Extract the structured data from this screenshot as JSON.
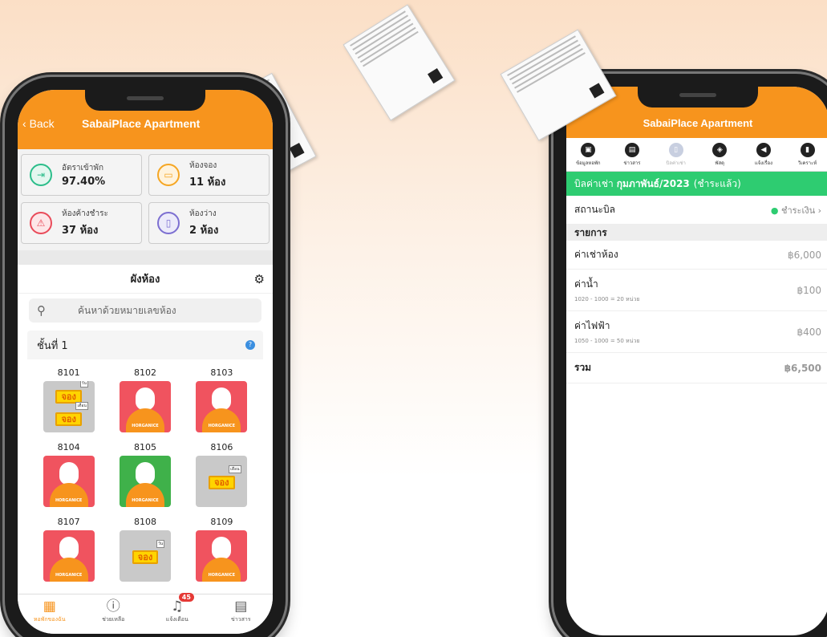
{
  "left_app": {
    "back": "Back",
    "title": "SabaiPlace Apartment",
    "stats": [
      {
        "label": "อัตราเข้าพัก",
        "value": "97.40%",
        "color": "#2bbd8a",
        "icon": "enter-icon"
      },
      {
        "label": "ห้องจอง",
        "value": "11 ห้อง",
        "color": "#f5a623",
        "icon": "booking-icon"
      },
      {
        "label": "ห้องค้างชำระ",
        "value": "37 ห้อง",
        "color": "#e94b5a",
        "icon": "overdue-icon"
      },
      {
        "label": "ห้องว่าง",
        "value": "2 ห้อง",
        "color": "#7c6fd1",
        "icon": "vacant-icon"
      }
    ],
    "section_title": "ผังห้อง",
    "search_placeholder": "ค้นหาด้วยหมายเลขห้อง",
    "floor_label": "ชั้นที่ 1",
    "rooms": [
      {
        "num": "8101",
        "status": "reserved-double"
      },
      {
        "num": "8102",
        "status": "overdue"
      },
      {
        "num": "8103",
        "status": "overdue"
      },
      {
        "num": "8104",
        "status": "overdue"
      },
      {
        "num": "8105",
        "status": "paid"
      },
      {
        "num": "8106",
        "status": "reserved-month"
      },
      {
        "num": "8107",
        "status": "overdue"
      },
      {
        "num": "8108",
        "status": "reserved-day"
      },
      {
        "num": "8109",
        "status": "overdue"
      }
    ],
    "tile_brand": "HORGANICE",
    "sign_text": "จอง",
    "cal_day": "วัน",
    "cal_month": "เดือน",
    "tabs": [
      {
        "label": "หอพักของฉัน",
        "icon": "building-icon"
      },
      {
        "label": "ช่วยเหลือ",
        "icon": "help-icon"
      },
      {
        "label": "แจ้งเตือน",
        "icon": "bell-icon",
        "badge": "45"
      },
      {
        "label": "ข่าวสาร",
        "icon": "news-icon"
      }
    ]
  },
  "right_app": {
    "title": "SabaiPlace Apartment",
    "menu": [
      {
        "label": "ข้อมูลหอพัก",
        "icon": "info-icon"
      },
      {
        "label": "ข่าวสาร",
        "icon": "news-icon"
      },
      {
        "label": "บิลค่าเช่า",
        "icon": "bill-icon"
      },
      {
        "label": "พัสดุ",
        "icon": "parcel-icon"
      },
      {
        "label": "แจ้งเรื่อง",
        "icon": "megaphone-icon"
      },
      {
        "label": "วิเคราะห์",
        "icon": "chart-icon"
      }
    ],
    "bill_prefix": "บิลค่าเช่า",
    "bill_month": "กุมภาพันธ์/2023",
    "bill_status_suffix": "(ชำระแล้ว)",
    "status_label": "สถานะบิล",
    "status_value": "ชำระเงิน",
    "items_header": "รายการ",
    "items": [
      {
        "name": "ค่าเช่าห้อง",
        "detail": "",
        "amount": "฿6,000"
      },
      {
        "name": "ค่าน้ำ",
        "detail": "1020 - 1000 = 20 หน่วย",
        "amount": "฿100"
      },
      {
        "name": "ค่าไฟฟ้า",
        "detail": "1050 - 1000 = 50 หน่วย",
        "amount": "฿400"
      }
    ],
    "total_label": "รวม",
    "total_amount": "฿6,500"
  }
}
